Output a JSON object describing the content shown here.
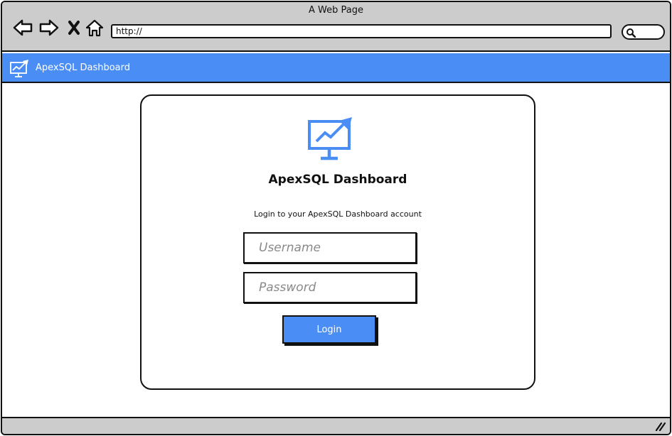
{
  "browser": {
    "title": "A Web Page",
    "url": "http://",
    "nav_icons": [
      "back-arrow-icon",
      "forward-arrow-icon",
      "close-icon",
      "home-icon"
    ],
    "search_icon": "search-icon"
  },
  "app_bar": {
    "name": "ApexSQL Dashboard",
    "logo_icon": "monitor-chart-icon",
    "color": "#4a8ef5"
  },
  "login": {
    "title": "ApexSQL Dashboard",
    "subtitle": "Login to your ApexSQL Dashboard account",
    "username_placeholder": "Username",
    "password_placeholder": "Password",
    "button_label": "Login",
    "logo_icon": "monitor-chart-icon"
  },
  "colors": {
    "accent": "#4a8ef5",
    "chrome": "#cccccc"
  }
}
